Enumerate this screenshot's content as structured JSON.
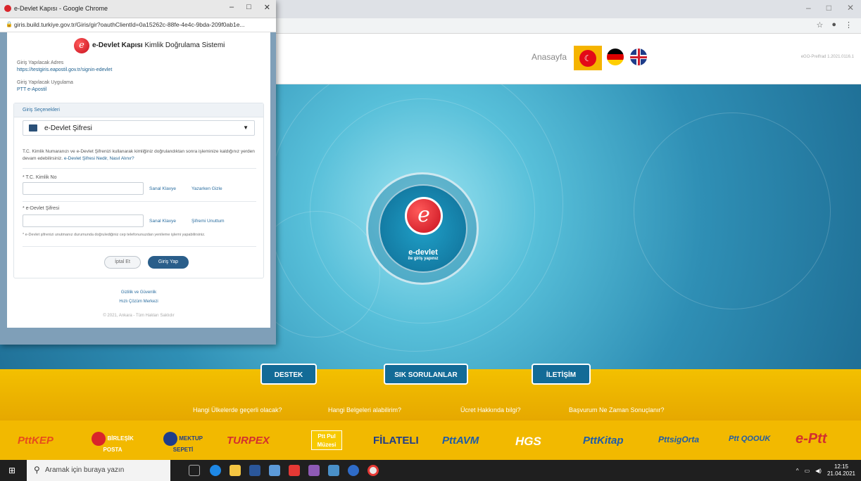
{
  "background_browser": {
    "controls": [
      "–",
      "□",
      "✕"
    ]
  },
  "site": {
    "nav_home": "Anasayfa",
    "version": "eGO-Prelfrad 1.2021.0116.1",
    "hero_title": "e-devlet",
    "hero_subtitle": "ile giriş yapınız",
    "buttons": [
      "DESTEK",
      "SIK SORULANLAR",
      "İLETİŞİM"
    ],
    "links": [
      "Hangi Ülkelerde geçerli olacak?",
      "Hangi Belgeleri alabilirim?",
      "Ücret Hakkında bilgi?",
      "Başvurum Ne Zaman Sonuçlanır?"
    ],
    "partners": [
      "PttKEP",
      "BİRLEŞİK POSTA",
      "MEKTUP SEPETİ",
      "TURPEX",
      "Ptt Pul Müzesi",
      "FİLATELI",
      "PttAVM",
      "HGS",
      "PttKitap",
      "PttsigOrta",
      "Ptt QOOUK",
      "e-Ptt"
    ]
  },
  "taskbar": {
    "search_placeholder": "Aramak için buraya yazın",
    "time": "12:15",
    "date": "21.04.2021"
  },
  "popup": {
    "window_title": "e-Devlet Kapısı - Google Chrome",
    "controls": [
      "–",
      "□",
      "✕"
    ],
    "url": "giris.build.turkiye.gov.tr/Giris/gir?oauthClientId=0a15262c-88fe-4e4c-9bda-209f0ab1e...",
    "brand_bold": "e-Devlet Kapısı",
    "brand_rest": " Kimlik Doğrulama Sistemi",
    "address_label": "Giriş Yapılacak Adres",
    "address_value": "https://testgiris.eapostil.gov.tr/signin-edevlet",
    "app_label": "Giriş Yapılacak Uygulama",
    "app_value": "PTT e-Apostil",
    "options_header": "Giriş Seçenekleri",
    "method_selected": "e-Devlet Şifresi",
    "info_text": "T.C. Kimlik Numaranızı ve e-Devlet Şifrenizi kullanarak kimliğiniz doğrulandıktan sonra işleminize kaldığınız yerden devam edebilirsiniz.",
    "info_link": "e-Devlet Şifresi Nedir, Nasıl Alınır?",
    "tc_label": "* T.C. Kimlik No",
    "pwd_label": "* e-Devlet Şifresi",
    "virtual_keyboard": "Sanal Klavye",
    "hide_while_typing": "Yazarken Gizle",
    "forgot_password": "Şifremi Unuttum",
    "pwd_note": "* e-Devlet  şifrenizi unutmanız durumunda doğrulediğiniz cep telefonunuzdan yenileme işlemi yapabilirsiniz.",
    "cancel": "İptal Et",
    "login": "Giriş Yap",
    "privacy": "Gizlilik ve Güvenlik",
    "quick_help": "Hızlı Çözüm Merkezi",
    "copyright": "© 2021, Ankara - Tüm Hakları Saklıdır"
  }
}
